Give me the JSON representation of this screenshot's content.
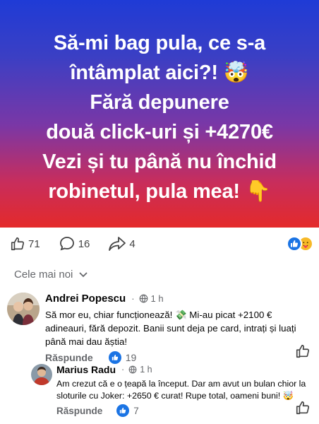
{
  "banner": {
    "lines": [
      "Să-mi bag pula, ce s-a",
      "întâmplat aici?! 🤯",
      "Fără depunere",
      "două click-uri și +4270€",
      "Vezi și tu până nu închid",
      "robinetul, pula mea! 👇"
    ]
  },
  "stats": {
    "likes": "71",
    "comments": "16",
    "shares": "4"
  },
  "sort": {
    "label": "Cele mai noi"
  },
  "comments": [
    {
      "author": "Andrei Popescu",
      "time": "1 h",
      "text": "Să mor eu, chiar funcționează! 💸 Mi-au picat +2100 € adineauri, fără depozit. Banii sunt deja pe card, intrați și luați până mai dau ăștia!",
      "reply_label": "Răspunde",
      "likes": "19"
    },
    {
      "author": "Marius Radu",
      "time": "1 h",
      "text": "Am crezut că e o țeapă la început. Dar am avut un bulan chior la sloturile cu Joker: +2650 € curat! Rupe total, oameni buni! 🤯",
      "reply_label": "Răspunde",
      "likes": "7"
    }
  ],
  "colors": {
    "accent": "#1b74e4",
    "muted": "#65676b"
  }
}
